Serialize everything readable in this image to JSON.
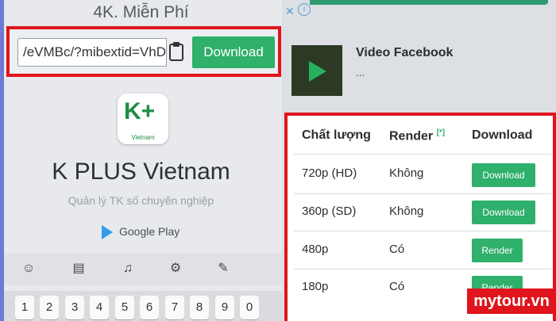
{
  "left": {
    "ad_title": "4K. Miễn Phí",
    "url_value": "/eVMBc/?mibextid=VhD",
    "download_label": "Download",
    "app": {
      "icon_text": "K+",
      "icon_sub": "Vietnam",
      "name": "K PLUS Vietnam",
      "subtitle": "Quản lý TK số chuyên nghiệp",
      "store": "Google Play"
    },
    "toolbar_icons": [
      "emoji-icon",
      "clipboard-icon",
      "microphone-icon",
      "settings-icon",
      "handwriting-icon"
    ],
    "number_keys": [
      "1",
      "2",
      "3",
      "4",
      "5",
      "6",
      "7",
      "8",
      "9",
      "0"
    ]
  },
  "right": {
    "video_title": "Video Facebook",
    "video_more": "...",
    "table": {
      "headers": {
        "quality": "Chất lượng",
        "render": "Render",
        "render_note": "[*]",
        "download": "Download"
      },
      "rows": [
        {
          "quality": "720p (HD)",
          "render": "Không",
          "action": "Download"
        },
        {
          "quality": "360p (SD)",
          "render": "Không",
          "action": "Download"
        },
        {
          "quality": "480p",
          "render": "Có",
          "action": "Render"
        },
        {
          "quality": "180p",
          "render": "Có",
          "action": "Render"
        }
      ]
    }
  },
  "watermark": "mytour.vn",
  "colors": {
    "accent_green": "#2fb06b",
    "highlight_red": "#e0141c"
  }
}
